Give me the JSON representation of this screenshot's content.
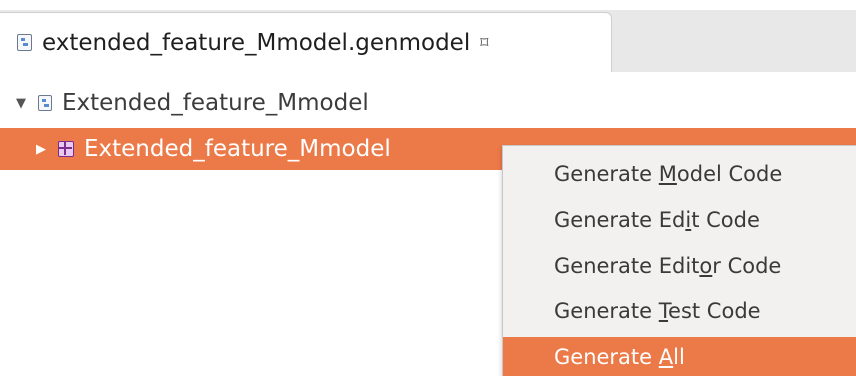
{
  "editor": {
    "tab_title": "extended_feature_Mmodel.genmodel",
    "tab_close_symbol": "⌑",
    "tab_icon": "genmodel-file-icon"
  },
  "tree": {
    "root": {
      "twisty": "▼",
      "icon": "genmodel-icon",
      "label": "Extended_feature_Mmodel",
      "expanded": true
    },
    "child": {
      "twisty": "▶",
      "icon": "genpackage-icon",
      "label": "Extended_feature_Mmodel",
      "selected": true,
      "expanded": false
    }
  },
  "context_menu": {
    "items": [
      {
        "prefix": "Generate ",
        "mnemonic": "M",
        "suffix": "odel Code",
        "selected": false
      },
      {
        "prefix": "Generate Ed",
        "mnemonic": "i",
        "suffix": "t Code",
        "selected": false
      },
      {
        "prefix": "Generate Edit",
        "mnemonic": "o",
        "suffix": "r Code",
        "selected": false
      },
      {
        "prefix": "Generate ",
        "mnemonic": "T",
        "suffix": "est Code",
        "selected": false
      },
      {
        "prefix": "Generate ",
        "mnemonic": "A",
        "suffix": "ll",
        "selected": true
      }
    ]
  },
  "colors": {
    "selection": "#ec7a48",
    "menu_background": "#f2f1f0",
    "text": "#3a3a3a"
  }
}
